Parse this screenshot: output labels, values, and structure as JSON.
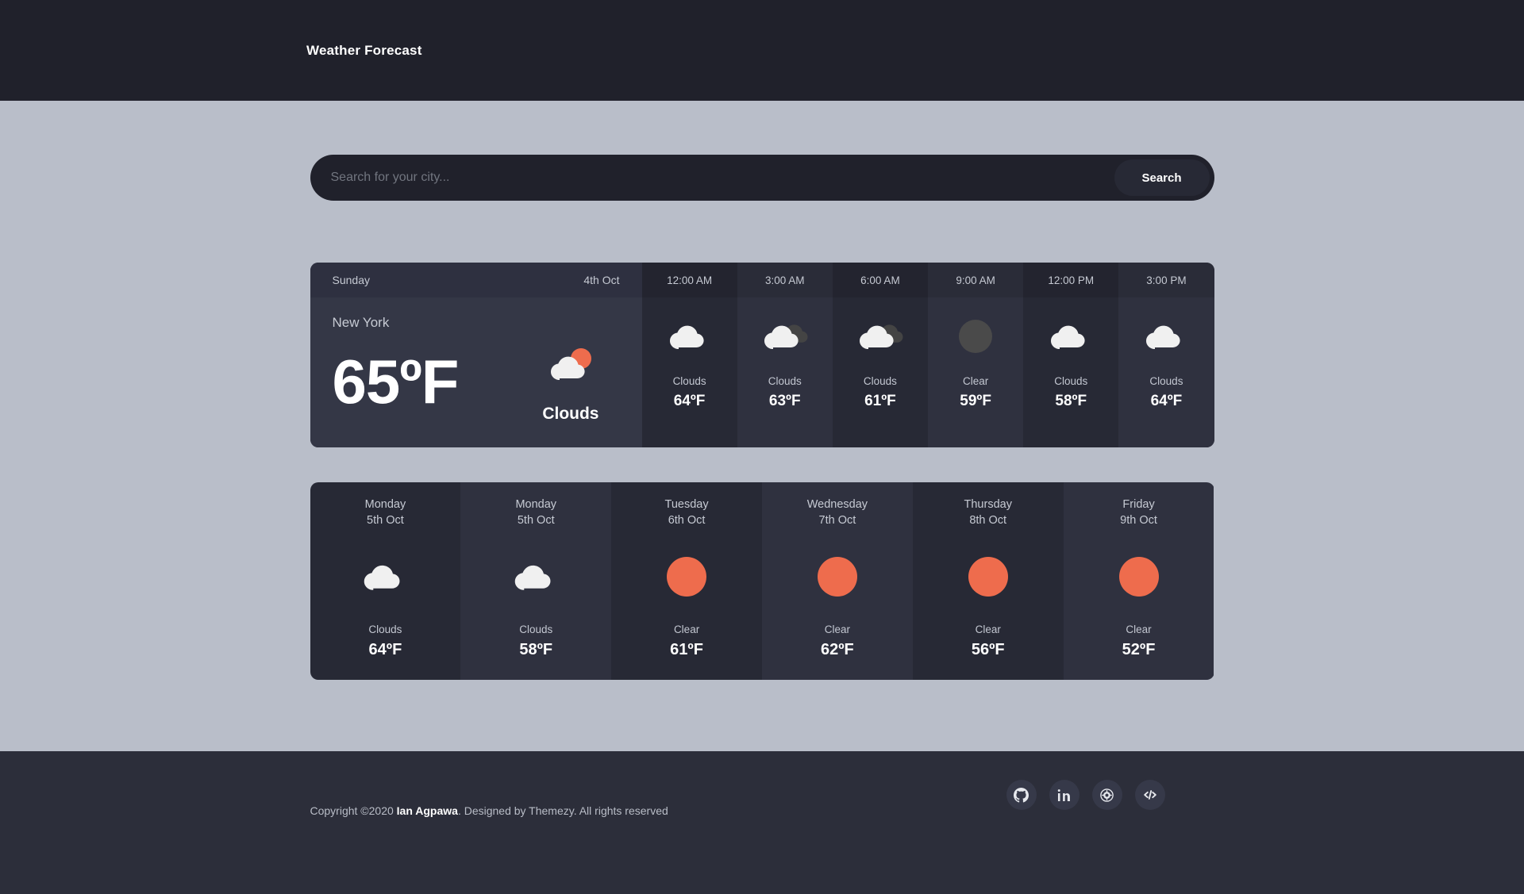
{
  "header": {
    "brand": "Weather Forecast"
  },
  "search": {
    "placeholder": "Search for your city...",
    "value": "",
    "button_label": "Search"
  },
  "today": {
    "day_label": "Sunday",
    "date_label": "4th Oct",
    "city": "New York",
    "temperature": "65ºF",
    "condition": "Clouds",
    "icon": "cloud-sun-icon"
  },
  "hourly": [
    {
      "time": "12:00 AM",
      "condition": "Clouds",
      "temperature": "64ºF",
      "icon": "cloud-icon"
    },
    {
      "time": "3:00 AM",
      "condition": "Clouds",
      "temperature": "63ºF",
      "icon": "cloud-night-icon"
    },
    {
      "time": "6:00 AM",
      "condition": "Clouds",
      "temperature": "61ºF",
      "icon": "cloud-night-icon"
    },
    {
      "time": "9:00 AM",
      "condition": "Clear",
      "temperature": "59ºF",
      "icon": "moon-dark-icon"
    },
    {
      "time": "12:00 PM",
      "condition": "Clouds",
      "temperature": "58ºF",
      "icon": "cloud-icon"
    },
    {
      "time": "3:00 PM",
      "condition": "Clouds",
      "temperature": "64ºF",
      "icon": "cloud-icon"
    }
  ],
  "daily": [
    {
      "day": "Monday",
      "date": "5th Oct",
      "condition": "Clouds",
      "temperature": "64ºF",
      "icon": "cloud-icon"
    },
    {
      "day": "Monday",
      "date": "5th Oct",
      "condition": "Clouds",
      "temperature": "58ºF",
      "icon": "cloud-icon"
    },
    {
      "day": "Tuesday",
      "date": "6th Oct",
      "condition": "Clear",
      "temperature": "61ºF",
      "icon": "sun-icon"
    },
    {
      "day": "Wednesday",
      "date": "7th Oct",
      "condition": "Clear",
      "temperature": "62ºF",
      "icon": "sun-icon"
    },
    {
      "day": "Thursday",
      "date": "8th Oct",
      "condition": "Clear",
      "temperature": "56ºF",
      "icon": "sun-icon"
    },
    {
      "day": "Friday",
      "date": "9th Oct",
      "condition": "Clear",
      "temperature": "52ºF",
      "icon": "sun-icon"
    }
  ],
  "footer": {
    "copyright_prefix": "Copyright ©2020 ",
    "author": "Ian Agpawa",
    "copyright_suffix": ". Designed by Themezy. All rights reserved",
    "socials": [
      {
        "name": "github-icon"
      },
      {
        "name": "linkedin-icon"
      },
      {
        "name": "badge-icon"
      },
      {
        "name": "code-icon"
      }
    ]
  },
  "colors": {
    "page_background": "#b9bec9",
    "panel_dark": "#272935",
    "panel_dark_alt": "#2f313f",
    "header_background": "#20212b",
    "footer_background": "#2c2e3a",
    "accent_orange": "#ee6c4d",
    "cloud_white": "#f0f0f0",
    "cloud_dark": "#444444"
  }
}
